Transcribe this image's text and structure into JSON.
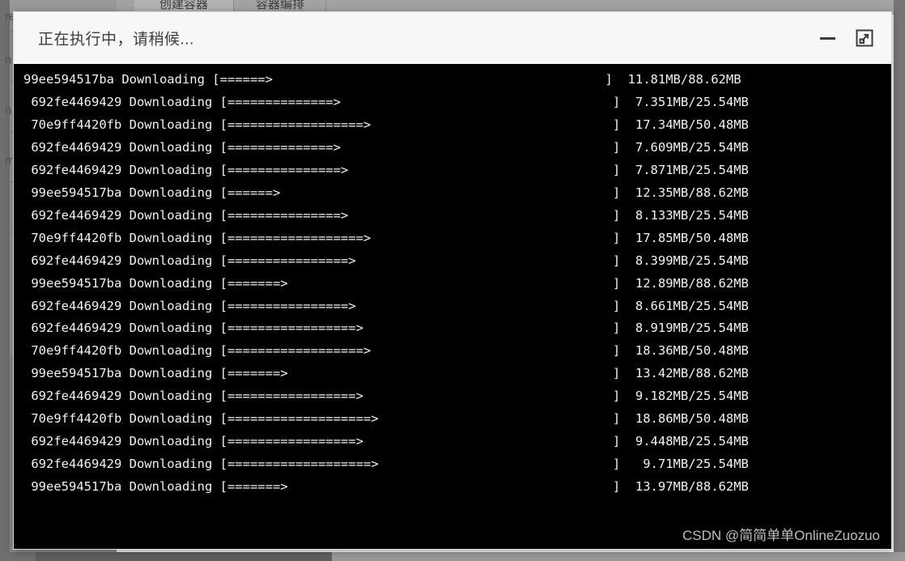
{
  "background": {
    "sidebar_items": [
      "re",
      "n",
      "n",
      "m"
    ],
    "tabs": [
      {
        "label": "创建容器",
        "active": true
      },
      {
        "label": "容器编排",
        "active": false
      }
    ]
  },
  "dialog": {
    "title": "正在执行中，请稍候...",
    "minimize_label": "minimize",
    "expand_label": "expand",
    "icons": {
      "minimize": "minimize-icon",
      "expand": "expand-icon"
    }
  },
  "terminal": {
    "background_color": "#000000",
    "text_color": "#f2f2f2",
    "bracket_open": "[",
    "bracket_close": "]",
    "action": "Downloading",
    "lines": [
      "99ee594517ba Downloading [======>                                            ]  11.81MB/88.62MB",
      " 692fe4469429 Downloading [==============>                                    ]  7.351MB/25.54MB",
      " 70e9ff4420fb Downloading [==================>                                ]  17.34MB/50.48MB",
      " 692fe4469429 Downloading [==============>                                    ]  7.609MB/25.54MB",
      " 692fe4469429 Downloading [===============>                                   ]  7.871MB/25.54MB",
      " 99ee594517ba Downloading [======>                                            ]  12.35MB/88.62MB",
      " 692fe4469429 Downloading [===============>                                   ]  8.133MB/25.54MB",
      " 70e9ff4420fb Downloading [==================>                                ]  17.85MB/50.48MB",
      " 692fe4469429 Downloading [================>                                  ]  8.399MB/25.54MB",
      " 99ee594517ba Downloading [=======>                                           ]  12.89MB/88.62MB",
      " 692fe4469429 Downloading [================>                                  ]  8.661MB/25.54MB",
      " 692fe4469429 Downloading [=================>                                 ]  8.919MB/25.54MB",
      " 70e9ff4420fb Downloading [==================>                                ]  18.36MB/50.48MB",
      " 99ee594517ba Downloading [=======>                                           ]  13.42MB/88.62MB",
      " 692fe4469429 Downloading [=================>                                 ]  9.182MB/25.54MB",
      " 70e9ff4420fb Downloading [===================>                               ]  18.86MB/50.48MB",
      " 692fe4469429 Downloading [=================>                                 ]  9.448MB/25.54MB",
      " 692fe4469429 Downloading [===================>                               ]   9.71MB/25.54MB",
      " 99ee594517ba Downloading [=======>                                           ]  13.97MB/88.62MB"
    ],
    "layers": [
      {
        "id": "99ee594517ba",
        "total": "88.62MB",
        "last_downloaded": "13.97MB"
      },
      {
        "id": "692fe4469429",
        "total": "25.54MB",
        "last_downloaded": "9.71MB"
      },
      {
        "id": "70e9ff4420fb",
        "total": "50.48MB",
        "last_downloaded": "18.86MB"
      }
    ]
  },
  "watermark": "CSDN @简简单单OnlineZuozuo"
}
